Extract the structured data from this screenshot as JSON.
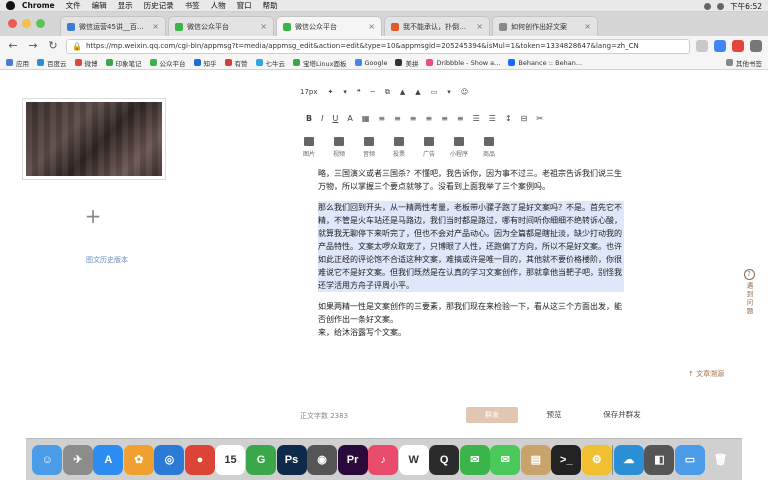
{
  "menubar": {
    "items": [
      "Chrome",
      "文件",
      "编辑",
      "显示",
      "历史记录",
      "书签",
      "人物",
      "窗口",
      "帮助"
    ],
    "clock": "下午6:52"
  },
  "tabs": [
    {
      "title": "微信运营45讲__百度搜索",
      "color": "#3b7bd8"
    },
    {
      "title": "微信公众平台",
      "color": "#3bb54a"
    },
    {
      "title": "微信公众平台",
      "color": "#3bb54a"
    },
    {
      "title": "我不能承认，扑倒推特的哈哈",
      "color": "#e0592a"
    },
    {
      "title": "如何创作出好文案",
      "color": "#888888"
    }
  ],
  "url": "https://mp.weixin.qq.com/cgi-bin/appmsg?t=media/appmsg_edit&action=edit&type=10&appmsgid=205245394&isMul=1&token=1334828647&lang=zh_CN",
  "bookmarks": {
    "items": [
      {
        "label": "应用",
        "color": "#4a7cd6"
      },
      {
        "label": "百度云",
        "color": "#2b8fd6"
      },
      {
        "label": "微博",
        "color": "#e5463b"
      },
      {
        "label": "印象笔记",
        "color": "#3aa84a"
      },
      {
        "label": "公众平台",
        "color": "#3bb54a"
      },
      {
        "label": "知乎",
        "color": "#1a6fd6"
      },
      {
        "label": "有赞",
        "color": "#d63a3a"
      },
      {
        "label": "七牛云",
        "color": "#31a3e2"
      },
      {
        "label": "宝塔Linux面板",
        "color": "#3aa84a"
      },
      {
        "label": "Google",
        "color": "#4285f4"
      },
      {
        "label": "美拼",
        "color": "#333333"
      },
      {
        "label": "Dribbble - Show a...",
        "color": "#ea4c89"
      },
      {
        "label": "Behance :: Behan...",
        "color": "#1769ff"
      }
    ],
    "other": "其他书签"
  },
  "editor": {
    "font_size": "17px",
    "format_row1": [
      "✦",
      "▾",
      "❝",
      "─",
      "⧉",
      "▲",
      "▲",
      "▭",
      "▾",
      "☺"
    ],
    "format_row2": [
      "B",
      "I",
      "U",
      "A",
      "▦",
      "≡",
      "≡",
      "≡",
      "≡",
      "≡",
      "≡",
      "☰",
      "☰",
      "↕",
      "⊟",
      "✂"
    ],
    "insert": [
      {
        "label": "图片",
        "icon": "image-icon"
      },
      {
        "label": "视频",
        "icon": "video-icon"
      },
      {
        "label": "音频",
        "icon": "audio-icon"
      },
      {
        "label": "投票",
        "icon": "vote-icon"
      },
      {
        "label": "广告",
        "icon": "ad-icon"
      },
      {
        "label": "小程序",
        "icon": "miniprogram-icon"
      },
      {
        "label": "商品",
        "icon": "product-icon"
      }
    ],
    "cover_link": "图文历史版本",
    "article": [
      "略，三国演义或者三国杀？不懂吧，我告诉你，因为事不过三。老祖宗告诉我们说三生万物，所以掌握三个要点就够了。没看到上面我举了三个案例吗。",
      "那么我们回到开头，从一精两性考量，老板带小骡子跑了是好文案吗？不是。首先它不精，不管是火车站还是马路边，我们当时都是路过，哪有时间听你细细不绝转诉心酸，就算我无聊停下来听完了，但也不会对产品动心。因为全篇都是瞎扯淡，缺少打动我的产品特性。文案太啰众取宠了，只博眼了人性，还跑偏了方向，所以不是好文案。也许如此正经的评论饱不合适这种文案，难搞或许是唯一目的，其他就不要价格楼阶，你很难说它不是好文案。但我们既然是在认真的学习文案创作，那就拿他当靶子吧，别怪我还学活用方舟子评周小平。",
      "如果两精一性是文案创作的三要素，那我们现在来检验一下，看从这三个方面出发，能否创作出一条好文案。",
      "来，给沐浴露写个文案。"
    ],
    "word_count": "正文字数 2383",
    "trace": "文章溯源",
    "rail_label": "遇到问题"
  },
  "buttons": {
    "send": "群发",
    "preview": "预览",
    "save": "保存并群发"
  },
  "dock": [
    {
      "name": "finder-icon",
      "color": "#4a9be8",
      "glyph": "☺"
    },
    {
      "name": "launchpad-icon",
      "color": "#8c8c8c",
      "glyph": "✈"
    },
    {
      "name": "appstore-icon",
      "color": "#2c8cf0",
      "glyph": "A"
    },
    {
      "name": "photos-icon",
      "color": "#f0a030",
      "glyph": "✿"
    },
    {
      "name": "safari-icon",
      "color": "#2b7ad6",
      "glyph": "◎"
    },
    {
      "name": "chrome-icon",
      "color": "#db4437",
      "glyph": "●"
    },
    {
      "name": "calendar-icon",
      "color": "#ffffff",
      "glyph": "15"
    },
    {
      "name": "evernote-icon",
      "color": "#3aa84a",
      "glyph": "G"
    },
    {
      "name": "photoshop-icon",
      "color": "#0e2a4a",
      "glyph": "Ps"
    },
    {
      "name": "media-icon",
      "color": "#555555",
      "glyph": "◉"
    },
    {
      "name": "premiere-icon",
      "color": "#2a0a3a",
      "glyph": "Pr"
    },
    {
      "name": "itunes-icon",
      "color": "#e94b6b",
      "glyph": "♪"
    },
    {
      "name": "wps-icon",
      "color": "#ffffff",
      "glyph": "W"
    },
    {
      "name": "qq-icon",
      "color": "#2b2b2b",
      "glyph": "Q"
    },
    {
      "name": "wechat-icon",
      "color": "#3bb54a",
      "glyph": "✉"
    },
    {
      "name": "messages-icon",
      "color": "#4ac85a",
      "glyph": "✉"
    },
    {
      "name": "preview-icon",
      "color": "#c9a46a",
      "glyph": "▤"
    },
    {
      "name": "terminal-icon",
      "color": "#222222",
      "glyph": ">_"
    },
    {
      "name": "colorsync-icon",
      "color": "#f0c030",
      "glyph": "⚙"
    },
    {
      "name": "baidu-netdisk-icon",
      "color": "#2b8fd6",
      "glyph": "☁"
    },
    {
      "name": "screenshot-icon",
      "color": "#555555",
      "glyph": "◧"
    },
    {
      "name": "folder-icon",
      "color": "#4a9be8",
      "glyph": "▭"
    },
    {
      "name": "trash-icon",
      "color": "#d0d0d0",
      "glyph": "🗑"
    }
  ]
}
